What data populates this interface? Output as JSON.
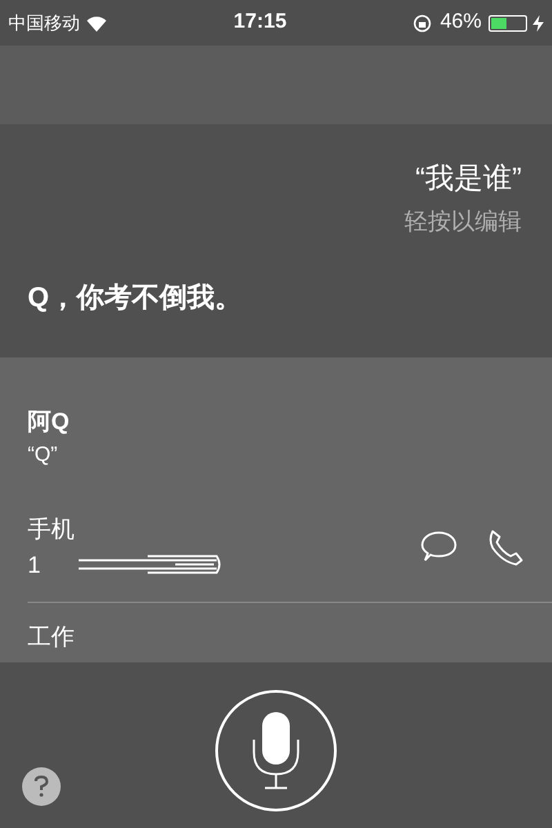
{
  "status_bar": {
    "carrier": "中国移动",
    "time": "17:15",
    "battery_percent": "46%",
    "charging": true
  },
  "query": {
    "text": "“我是谁”",
    "hint": "轻按以编辑"
  },
  "answer": "Q，你考不倒我。",
  "contact": {
    "name": "阿Q",
    "nickname": "“Q”",
    "fields": [
      {
        "kind": "phone",
        "label": "手机",
        "value": "1"
      },
      {
        "kind": "cut",
        "label": "工作"
      }
    ]
  }
}
